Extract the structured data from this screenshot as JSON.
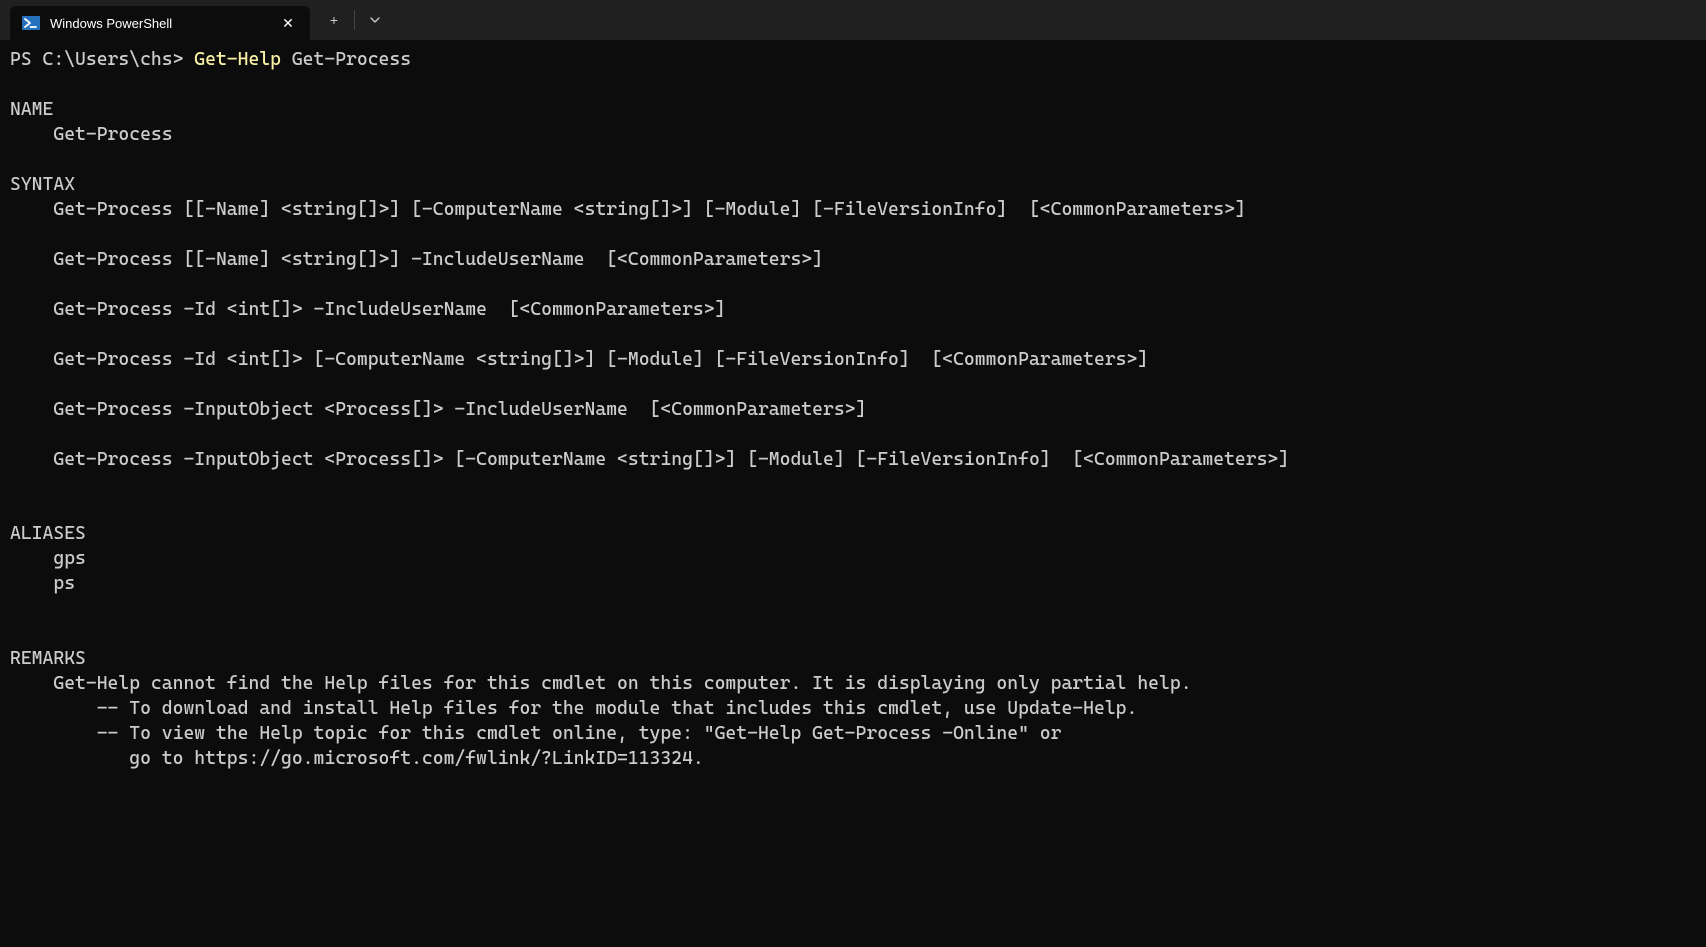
{
  "titlebar": {
    "tab_title": "Windows PowerShell",
    "new_tab": "+",
    "dropdown": "⌄",
    "close": "✕"
  },
  "terminal": {
    "prompt": "PS C:\\Users\\chs> ",
    "command_part1": "Get-Help",
    "command_part2": " Get-Process",
    "blank": "",
    "name_header": "NAME",
    "name_value": "    Get-Process",
    "syntax_header": "SYNTAX",
    "syntax1": "    Get-Process [[-Name] <string[]>] [-ComputerName <string[]>] [-Module] [-FileVersionInfo]  [<CommonParameters>]",
    "syntax2": "    Get-Process [[-Name] <string[]>] -IncludeUserName  [<CommonParameters>]",
    "syntax3": "    Get-Process -Id <int[]> -IncludeUserName  [<CommonParameters>]",
    "syntax4": "    Get-Process -Id <int[]> [-ComputerName <string[]>] [-Module] [-FileVersionInfo]  [<CommonParameters>]",
    "syntax5": "    Get-Process -InputObject <Process[]> -IncludeUserName  [<CommonParameters>]",
    "syntax6": "    Get-Process -InputObject <Process[]> [-ComputerName <string[]>] [-Module] [-FileVersionInfo]  [<CommonParameters>]",
    "aliases_header": "ALIASES",
    "alias1": "    gps",
    "alias2": "    ps",
    "remarks_header": "REMARKS",
    "remarks1": "    Get-Help cannot find the Help files for this cmdlet on this computer. It is displaying only partial help.",
    "remarks2": "        -- To download and install Help files for the module that includes this cmdlet, use Update-Help.",
    "remarks3": "        -- To view the Help topic for this cmdlet online, type: \"Get-Help Get-Process -Online\" or",
    "remarks4": "           go to https://go.microsoft.com/fwlink/?LinkID=113324."
  }
}
